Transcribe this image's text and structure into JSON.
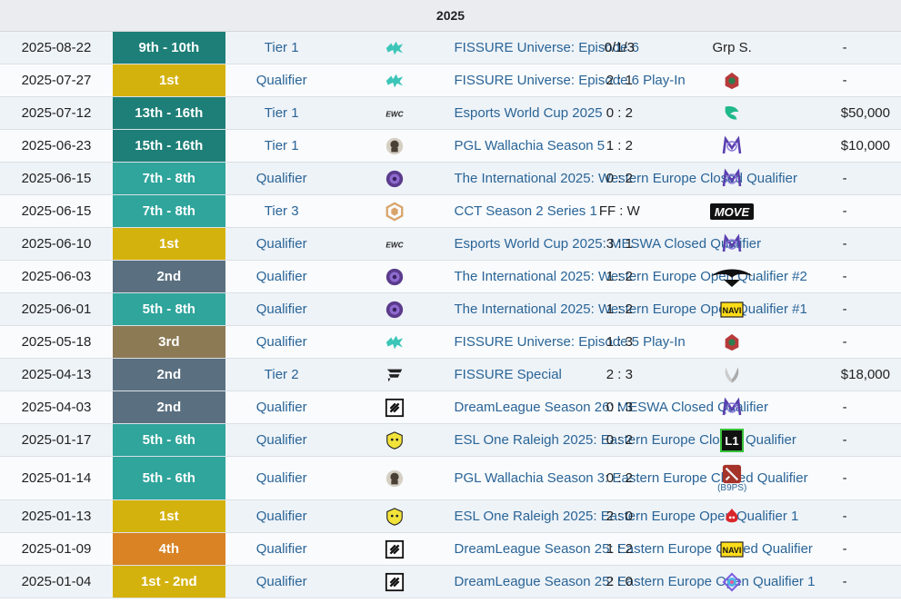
{
  "year": "2025",
  "colors": {
    "gold": "#d4b20e",
    "silver": "#5a7080",
    "bronze": "#8c7a55",
    "fourth": "#d98324",
    "teal": "#2fa59c",
    "darkteal": "#1d7f77",
    "link": "#2a6496"
  },
  "rows": [
    {
      "date": "2025-08-22",
      "place": "9th - 10th",
      "place_color": "darkteal",
      "tier": "Tier 1",
      "tournament": "FISSURE Universe: Episode 6",
      "tournament_icon": "fissure-icon",
      "score": "0/1/3",
      "opponent": "Grp S.",
      "opponent_icon": "",
      "opponent_sub": "",
      "prize": "-"
    },
    {
      "date": "2025-07-27",
      "place": "1st",
      "place_color": "gold",
      "tier": "Qualifier",
      "tournament": "FISSURE Universe: Episode 6 Play-In",
      "tournament_icon": "fissure-icon",
      "score": "2 : 1",
      "opponent": "",
      "opponent_icon": "red-team-icon",
      "opponent_sub": "",
      "prize": "-"
    },
    {
      "date": "2025-07-12",
      "place": "13th - 16th",
      "place_color": "darkteal",
      "tier": "Tier 1",
      "tournament": "Esports World Cup 2025",
      "tournament_icon": "ewc-icon",
      "score": "0 : 2",
      "opponent": "",
      "opponent_icon": "falcons-icon",
      "opponent_sub": "",
      "prize": "$50,000"
    },
    {
      "date": "2025-06-23",
      "place": "15th - 16th",
      "place_color": "darkteal",
      "tier": "Tier 1",
      "tournament": "PGL Wallachia Season 5",
      "tournament_icon": "pgl-icon",
      "score": "1 : 2",
      "opponent": "",
      "opponent_icon": "nigma-icon",
      "opponent_sub": "",
      "prize": "$10,000"
    },
    {
      "date": "2025-06-15",
      "place": "7th - 8th",
      "place_color": "teal",
      "tier": "Qualifier",
      "tournament": "The International 2025: Western Europe Closed Qualifier",
      "tournament_icon": "ti-icon",
      "score": "0 : 2",
      "opponent": "",
      "opponent_icon": "nigma-icon",
      "opponent_sub": "",
      "prize": "-"
    },
    {
      "date": "2025-06-15",
      "place": "7th - 8th",
      "place_color": "teal",
      "tier": "Tier 3",
      "tournament": "CCT Season 2 Series 1",
      "tournament_icon": "cct-icon",
      "score": "FF : W",
      "opponent": "",
      "opponent_icon": "move-icon",
      "opponent_sub": "",
      "prize": "-"
    },
    {
      "date": "2025-06-10",
      "place": "1st",
      "place_color": "gold",
      "tier": "Qualifier",
      "tournament": "Esports World Cup 2025: MESWA Closed Qualifier",
      "tournament_icon": "ewc-icon",
      "score": "3 : 1",
      "opponent": "",
      "opponent_icon": "nigma-icon",
      "opponent_sub": "",
      "prize": "-"
    },
    {
      "date": "2025-06-03",
      "place": "2nd",
      "place_color": "silver",
      "tier": "Qualifier",
      "tournament": "The International 2025: Western Europe Open Qualifier #2",
      "tournament_icon": "ti-icon",
      "score": "1 : 2",
      "opponent": "",
      "opponent_icon": "liquid-icon",
      "opponent_sub": "",
      "prize": "-"
    },
    {
      "date": "2025-06-01",
      "place": "5th - 8th",
      "place_color": "teal",
      "tier": "Qualifier",
      "tournament": "The International 2025: Western Europe Open Qualifier #1",
      "tournament_icon": "ti-icon",
      "score": "1 : 2",
      "opponent": "",
      "opponent_icon": "navi-icon",
      "opponent_sub": "",
      "prize": "-"
    },
    {
      "date": "2025-05-18",
      "place": "3rd",
      "place_color": "bronze",
      "tier": "Qualifier",
      "tournament": "FISSURE Universe: Episode 5 Play-In",
      "tournament_icon": "fissure-icon",
      "score": "1 : 3",
      "opponent": "",
      "opponent_icon": "red-team-icon",
      "opponent_sub": "",
      "prize": "-"
    },
    {
      "date": "2025-04-13",
      "place": "2nd",
      "place_color": "silver",
      "tier": "Tier 2",
      "tournament": "FISSURE Special",
      "tournament_icon": "fissure-special-icon",
      "score": "2 : 3",
      "opponent": "",
      "opponent_icon": "wings-icon",
      "opponent_sub": "",
      "prize": "$18,000"
    },
    {
      "date": "2025-04-03",
      "place": "2nd",
      "place_color": "silver",
      "tier": "Qualifier",
      "tournament": "DreamLeague Season 26: MESWA Closed Qualifier",
      "tournament_icon": "dreamleague-icon",
      "score": "0 : 3",
      "opponent": "",
      "opponent_icon": "nigma-icon",
      "opponent_sub": "",
      "prize": "-"
    },
    {
      "date": "2025-01-17",
      "place": "5th - 6th",
      "place_color": "teal",
      "tier": "Qualifier",
      "tournament": "ESL One Raleigh 2025: Eastern Europe Closed Qualifier",
      "tournament_icon": "esl-icon",
      "score": "0 : 2",
      "opponent": "",
      "opponent_icon": "l1-icon",
      "opponent_sub": "",
      "prize": "-"
    },
    {
      "date": "2025-01-14",
      "place": "5th - 6th",
      "place_color": "teal",
      "tier": "Qualifier",
      "tournament": "PGL Wallachia Season 3: Eastern Europe Closed Qualifier",
      "tournament_icon": "pgl-icon",
      "score": "0 : 2",
      "opponent": "",
      "opponent_icon": "dota-icon",
      "opponent_sub": "(B9PS)",
      "prize": "-"
    },
    {
      "date": "2025-01-13",
      "place": "1st",
      "place_color": "gold",
      "tier": "Qualifier",
      "tournament": "ESL One Raleigh 2025: Eastern Europe Open Qualifier 1",
      "tournament_icon": "esl-icon",
      "score": "2 : 0",
      "opponent": "",
      "opponent_icon": "red-flame-icon",
      "opponent_sub": "",
      "prize": "-"
    },
    {
      "date": "2025-01-09",
      "place": "4th",
      "place_color": "fourth",
      "tier": "Qualifier",
      "tournament": "DreamLeague Season 25: Eastern Europe Closed Qualifier",
      "tournament_icon": "dreamleague-icon",
      "score": "1 : 2",
      "opponent": "",
      "opponent_icon": "navi-icon",
      "opponent_sub": "",
      "prize": "-"
    },
    {
      "date": "2025-01-04",
      "place": "1st - 2nd",
      "place_color": "gold",
      "tier": "Qualifier",
      "tournament": "DreamLeague Season 25: Eastern Europe Open Qualifier 1",
      "tournament_icon": "dreamleague-icon",
      "score": "2 : 0",
      "opponent": "",
      "opponent_icon": "colorful-icon",
      "opponent_sub": "",
      "prize": "-"
    }
  ]
}
